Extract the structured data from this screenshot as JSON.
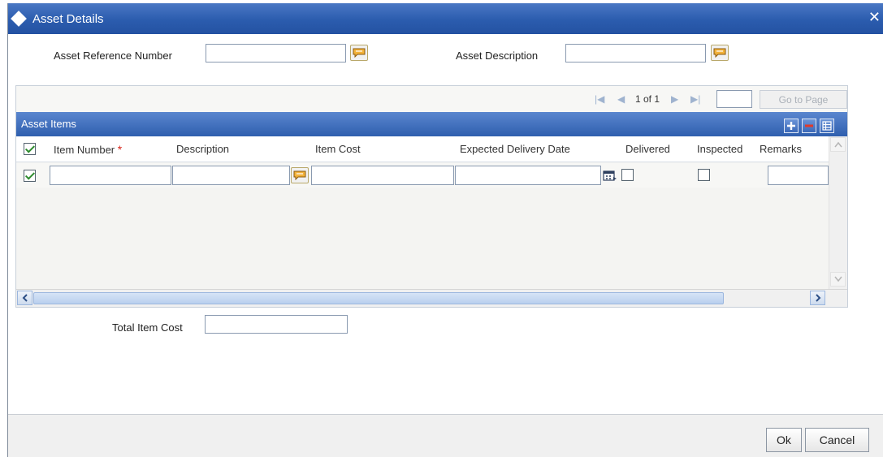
{
  "window": {
    "title": "Asset Details"
  },
  "header": {
    "asset_ref_label": "Asset Reference Number",
    "asset_ref_value": "",
    "asset_desc_label": "Asset Description",
    "asset_desc_value": ""
  },
  "pager": {
    "page_text": "1 of 1",
    "page_input": "",
    "goto_label": "Go to Page"
  },
  "grid": {
    "title": "Asset Items",
    "columns": [
      {
        "label": "Item Number",
        "required": true
      },
      {
        "label": "Description"
      },
      {
        "label": "Item Cost"
      },
      {
        "label": "Expected Delivery Date"
      },
      {
        "label": "Delivered"
      },
      {
        "label": "Inspected"
      },
      {
        "label": "Remarks"
      }
    ],
    "rows": [
      {
        "selected": true,
        "item_number": "",
        "description": "",
        "item_cost": "",
        "expected_delivery_date": "",
        "delivered": false,
        "inspected": false,
        "remarks": ""
      }
    ]
  },
  "totals": {
    "total_label": "Total Item Cost",
    "total_value": ""
  },
  "footer": {
    "ok_label": "Ok",
    "cancel_label": "Cancel"
  },
  "colors": {
    "title_bar": "#2b5cae",
    "section_bar": "#3a68b8",
    "required_marker": "#d8261b"
  }
}
